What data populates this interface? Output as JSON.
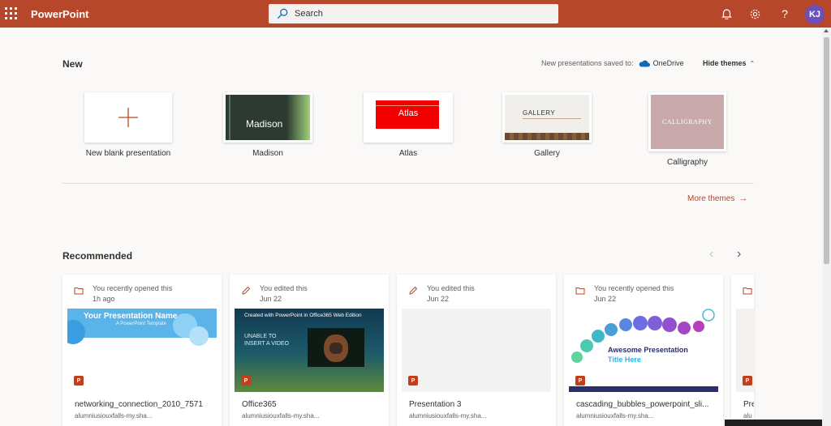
{
  "header": {
    "app_title": "PowerPoint",
    "search_placeholder": "Search",
    "avatar_initials": "KJ"
  },
  "new_section": {
    "title": "New",
    "saved_to_label": "New presentations saved to:",
    "saved_to_service": "OneDrive",
    "hide_themes": "Hide themes",
    "templates": [
      {
        "label": "New blank presentation"
      },
      {
        "label": "Madison",
        "preview_text": "Madison"
      },
      {
        "label": "Atlas",
        "preview_text": "Atlas"
      },
      {
        "label": "Gallery",
        "preview_text": "GALLERY"
      },
      {
        "label": "Calligraphy",
        "preview_text": "CALLIGRAPHY"
      }
    ],
    "more_themes": "More themes"
  },
  "recommended": {
    "title": "Recommended",
    "cards": [
      {
        "action": "You recently opened this",
        "time": "1h ago",
        "icon": "folder-icon",
        "preview_title": "Your Presentation Name",
        "preview_sub": "A PowerPoint Template",
        "file_name": "networking_connection_2010_7571",
        "location": "alumniusiouxfalls-my.sha..."
      },
      {
        "action": "You edited this",
        "time": "Jun 22",
        "icon": "pencil-icon",
        "preview_title": "Created with PowerPoint in Office365 Web Edition",
        "preview_sub": "UNABLE TO INSERT A VIDEO",
        "file_name": "Office365",
        "location": "alumniusiouxfalls-my.sha..."
      },
      {
        "action": "You edited this",
        "time": "Jun 22",
        "icon": "pencil-icon",
        "file_name": "Presentation 3",
        "location": "alumniusiouxfalls-my.sha..."
      },
      {
        "action": "You recently opened this",
        "time": "Jun 22",
        "icon": "folder-icon",
        "preview_title": "Awesome Presentation",
        "preview_sub": "Title Here",
        "file_name": "cascading_bubbles_powerpoint_sli...",
        "location": "alumniusiouxfalls-my.sha..."
      },
      {
        "file_name": "Pre",
        "location": "alu"
      }
    ]
  },
  "colors": {
    "brand": "#b7472a",
    "accent_link": "#b7472a",
    "avatar": "#6b4fbb"
  }
}
